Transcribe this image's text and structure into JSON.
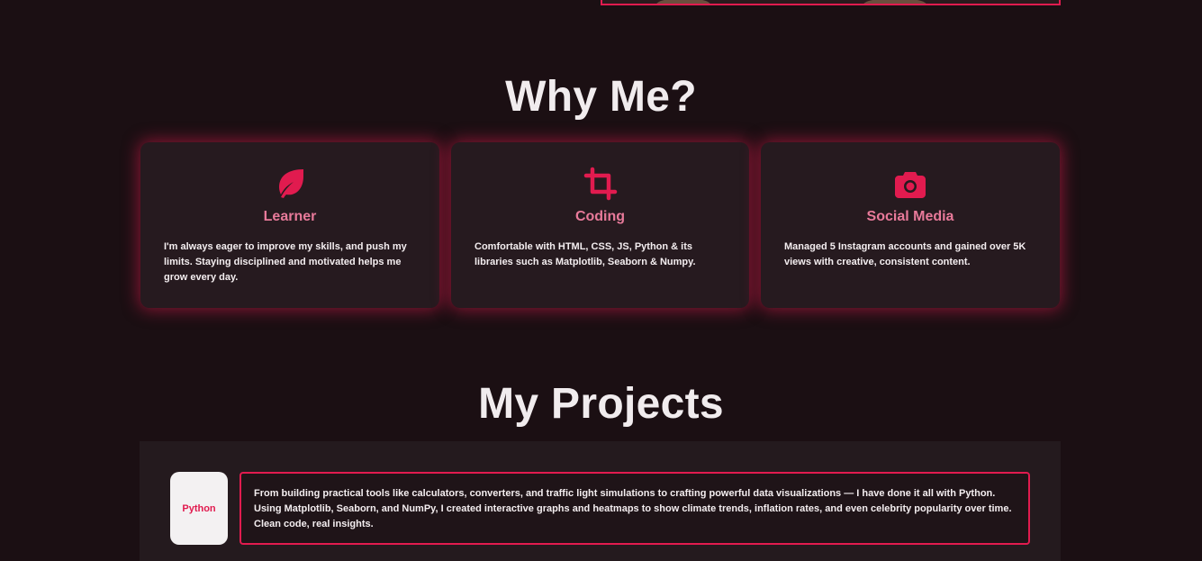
{
  "why": {
    "title": "Why Me?",
    "cards": [
      {
        "icon": "leaf-icon",
        "title": "Learner",
        "text": "I'm always eager to improve my skills, and push my limits. Staying disciplined and motivated helps me grow every day."
      },
      {
        "icon": "crop-icon",
        "title": "Coding",
        "text": "Comfortable with HTML, CSS, JS, Python & its libraries such as Matplotlib, Seaborn & Numpy."
      },
      {
        "icon": "camera-icon",
        "title": "Social Media",
        "text": "Managed 5 Instagram accounts and gained over 5K views with creative, consistent content."
      }
    ]
  },
  "projects": {
    "title": "My Projects",
    "items": [
      {
        "badge": "Python",
        "description": "From building practical tools like calculators, converters, and traffic light simulations to crafting powerful data visualizations — I have done it all with Python. Using Matplotlib, Seaborn, and NumPy, I created interactive graphs and heatmaps to show climate trends, inflation rates, and even celebrity popularity over time. Clean code, real insights."
      }
    ]
  },
  "colors": {
    "accent": "#e11b4f",
    "background": "#1b0f13",
    "card": "#261a1f",
    "card_title": "#e87a9a"
  }
}
